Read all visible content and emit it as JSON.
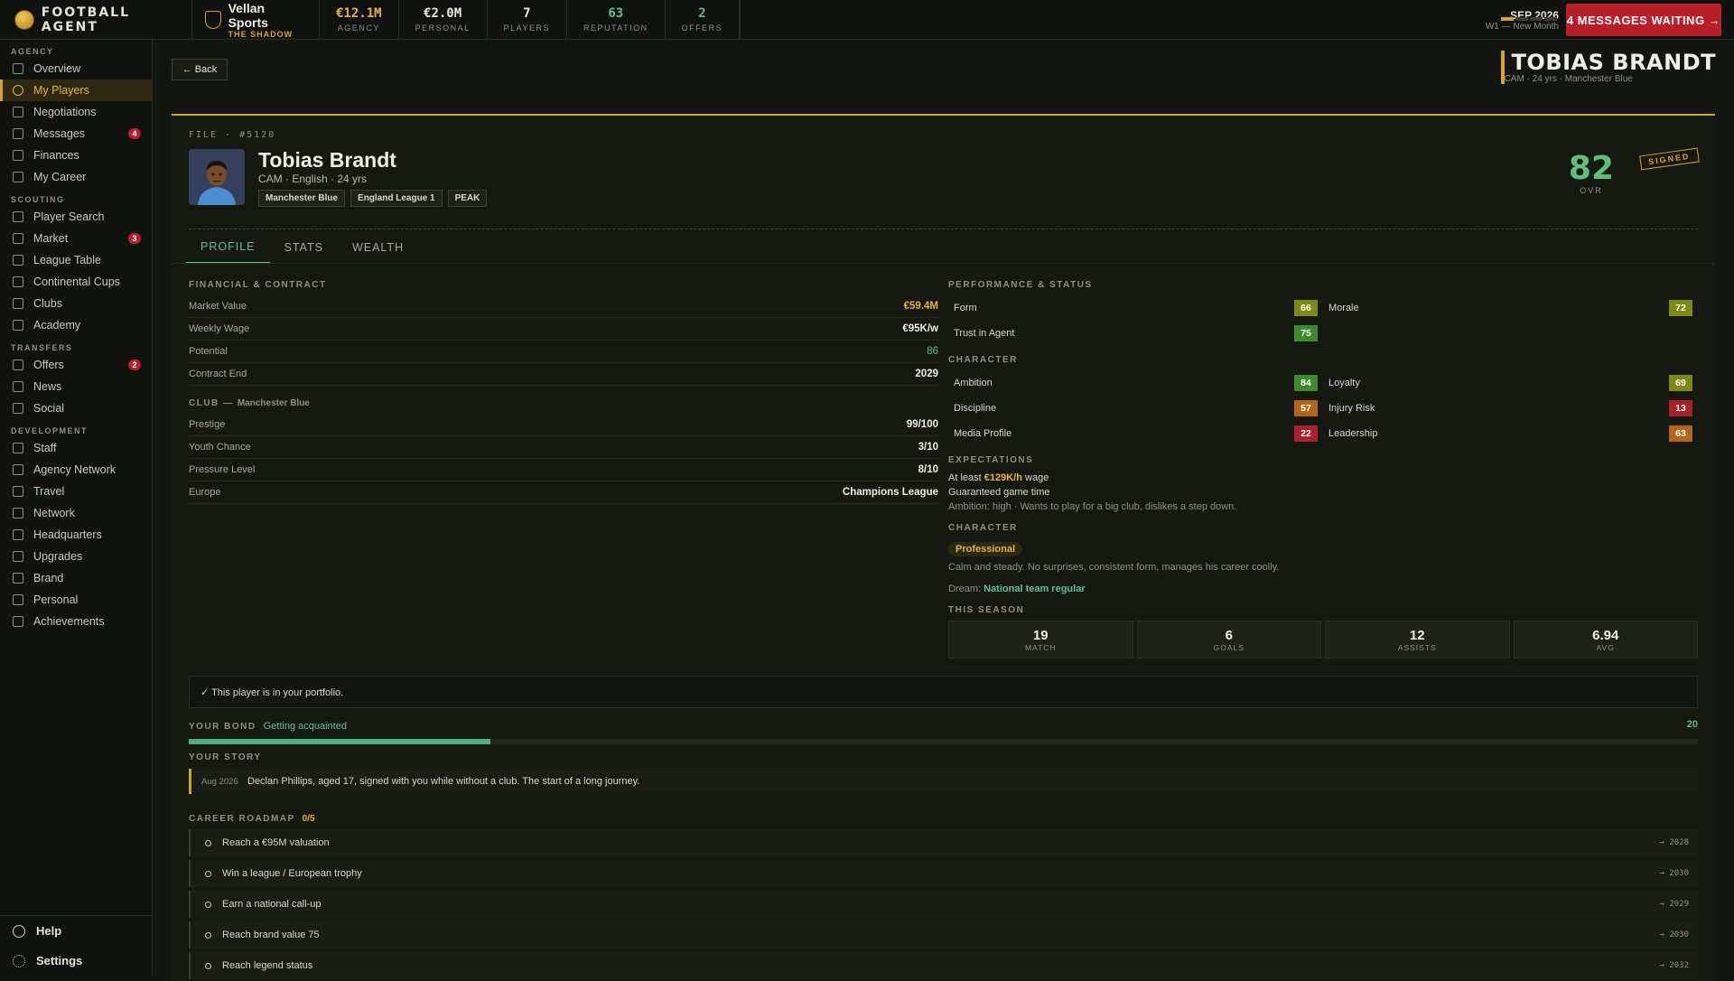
{
  "top": {
    "brand": "FOOTBALL AGENT",
    "agency_name": "Vellan Sports",
    "agency_sub": "THE SHADOW",
    "stats": [
      {
        "value": "€12.1M",
        "label": "AGENCY",
        "color": "#e8b33c"
      },
      {
        "value": "€2.0M",
        "label": "PERSONAL",
        "color": "#e8e6dc"
      },
      {
        "value": "7",
        "label": "PLAYERS",
        "color": "#e8e6dc"
      },
      {
        "value": "63",
        "label": "REPUTATION",
        "color": "#5fbf7a"
      },
      {
        "value": "2",
        "label": "OFFERS",
        "color": "#5fbf7a"
      }
    ],
    "date": "SEP 2026",
    "week": "W1 — New Month",
    "messages_btn": "4 MESSAGES WAITING →"
  },
  "sidebar": {
    "sections": [
      {
        "title": "AGENCY",
        "items": [
          {
            "label": "Overview"
          },
          {
            "label": "My Players",
            "active": true
          },
          {
            "label": "Negotiations"
          },
          {
            "label": "Messages",
            "badge": "4"
          },
          {
            "label": "Finances"
          },
          {
            "label": "My Career"
          }
        ]
      },
      {
        "title": "SCOUTING",
        "items": [
          {
            "label": "Player Search"
          },
          {
            "label": "Market",
            "badge": "3"
          },
          {
            "label": "League Table"
          },
          {
            "label": "Continental Cups"
          },
          {
            "label": "Clubs"
          },
          {
            "label": "Academy"
          }
        ]
      },
      {
        "title": "TRANSFERS",
        "items": [
          {
            "label": "Offers",
            "badge": "2"
          },
          {
            "label": "News"
          },
          {
            "label": "Social"
          }
        ]
      },
      {
        "title": "DEVELOPMENT",
        "items": [
          {
            "label": "Staff"
          },
          {
            "label": "Agency Network"
          },
          {
            "label": "Travel"
          },
          {
            "label": "Network"
          },
          {
            "label": "Headquarters"
          },
          {
            "label": "Upgrades"
          },
          {
            "label": "Brand"
          },
          {
            "label": "Personal"
          },
          {
            "label": "Achievements"
          }
        ]
      }
    ],
    "help": "Help",
    "settings": "Settings"
  },
  "header": {
    "back": "← Back",
    "player_name": "TOBIAS BRANDT",
    "player_sub": "CAM · 24 yrs · Manchester Blue"
  },
  "player": {
    "file": "FILE · #5120",
    "name": "Tobias Brandt",
    "meta": "CAM · English · 24 yrs",
    "tags": [
      "Manchester Blue",
      "England League 1",
      "PEAK"
    ],
    "ovr": "82",
    "ovr_label": "OVR",
    "stamp": "SIGNED"
  },
  "tabs": [
    "PROFILE",
    "STATS",
    "WEALTH"
  ],
  "financial": {
    "title": "FINANCIAL & CONTRACT",
    "rows": [
      {
        "label": "Market Value",
        "value": "€59.4M",
        "style": "gold"
      },
      {
        "label": "Weekly Wage",
        "value": "€95K/w"
      },
      {
        "label": "Potential",
        "value": "86",
        "style": "green"
      },
      {
        "label": "Contract End",
        "value": "2029"
      }
    ]
  },
  "club": {
    "title": "CLUB — ",
    "club_name": "Manchester Blue",
    "rows": [
      {
        "label": "Prestige",
        "value": "99/100"
      },
      {
        "label": "Youth Chance",
        "value": "3/10"
      },
      {
        "label": "Pressure Level",
        "value": "8/10"
      },
      {
        "label": "Europe",
        "value": "Champions League"
      }
    ]
  },
  "performance": {
    "title": "PERFORMANCE & STATUS",
    "items": [
      {
        "label": "Form",
        "value": "66",
        "color": "#7a8a14"
      },
      {
        "label": "Morale",
        "value": "72",
        "color": "#7a8a14"
      },
      {
        "label": "Trust in Agent",
        "value": "75",
        "color": "#3d8a2c"
      }
    ]
  },
  "character": {
    "title": "CHARACTER",
    "items": [
      {
        "label": "Ambition",
        "value": "84",
        "color": "#3d8a2c"
      },
      {
        "label": "Loyalty",
        "value": "69",
        "color": "#7a8a14"
      },
      {
        "label": "Discipline",
        "value": "57",
        "color": "#b5651a"
      },
      {
        "label": "Injury Risk",
        "value": "13",
        "color": "#a8222b"
      },
      {
        "label": "Media Profile",
        "value": "22",
        "color": "#a8222b"
      },
      {
        "label": "Leadership",
        "value": "63",
        "color": "#b5651a"
      }
    ]
  },
  "expectations": {
    "title": "EXPECTATIONS",
    "wage_prefix": "At least ",
    "wage": "€129K/h",
    "wage_suffix": " wage",
    "line2": "Guaranteed game time",
    "line3": "Ambition: high · Wants to play for a big club, dislikes a step down."
  },
  "character2": {
    "title": "CHARACTER",
    "type": "Professional",
    "desc": "Calm and steady. No surprises, consistent form, manages his career coolly.",
    "dream_label": "Dream: ",
    "dream": "National team regular"
  },
  "season": {
    "title": "THIS SEASON",
    "items": [
      {
        "value": "19",
        "label": "MATCH"
      },
      {
        "value": "6",
        "label": "GOALS"
      },
      {
        "value": "12",
        "label": "ASSISTS"
      },
      {
        "value": "6.94",
        "label": "AVG"
      }
    ]
  },
  "portfolio": "✓ This player is in your portfolio.",
  "bond": {
    "title": "YOUR BOND",
    "status": "Getting acquainted",
    "value": "20",
    "progress": 0.2
  },
  "story": {
    "title": "YOUR STORY",
    "date": "Aug 2026",
    "text": "Declan Phillips, aged 17, signed with you while without a club. The start of a long journey."
  },
  "roadmap": {
    "title": "CAREER ROADMAP",
    "count": "0/5",
    "items": [
      {
        "label": "Reach a €95M valuation",
        "year": "→ 2028"
      },
      {
        "label": "Win a league / European trophy",
        "year": "→ 2030"
      },
      {
        "label": "Earn a national call-up",
        "year": "→ 2029"
      },
      {
        "label": "Reach brand value 75",
        "year": "→ 2030"
      },
      {
        "label": "Reach legend status",
        "year": "→ 2032"
      }
    ]
  }
}
